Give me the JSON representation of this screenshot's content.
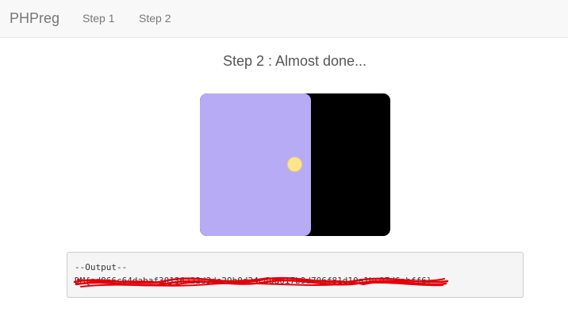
{
  "navbar": {
    "brand": "PHPreg",
    "links": [
      {
        "label": "Step 1"
      },
      {
        "label": "Step 2"
      }
    ]
  },
  "main": {
    "heading": "Step 2 : Almost done..."
  },
  "output": {
    "header": "--Output--",
    "flag": "DM{ad866c64dabaf30136a22d3de29b0d24c4da617b9d706f81d10a1bc97d6abff6}"
  },
  "colors": {
    "door_panel": "#b8abf5",
    "door_frame": "#000000",
    "door_knob": "#fde58e",
    "redaction_scribble": "#e3000b"
  }
}
